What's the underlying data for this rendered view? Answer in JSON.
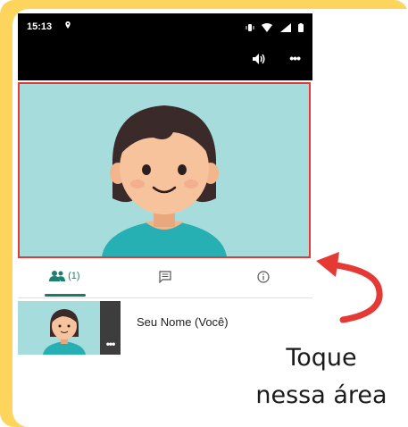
{
  "status_bar": {
    "time": "15:13",
    "icons": [
      "location-icon",
      "vibrate-icon",
      "wifi-icon",
      "signal-icon",
      "battery-icon"
    ]
  },
  "call_toolbar": {
    "icons": [
      "speaker-icon",
      "more-options-icon"
    ],
    "more_label": "•••"
  },
  "tabs": [
    {
      "icon": "people-icon",
      "label": "(1)",
      "active": true
    },
    {
      "icon": "chat-icon",
      "label": ""
    },
    {
      "icon": "info-icon",
      "label": ""
    }
  ],
  "participant": {
    "name": "Seu Nome (Você)",
    "more_label": "•••"
  },
  "annotation": {
    "line1": "Toque",
    "line2": "nessa área"
  },
  "colors": {
    "background_frame": "#fdd45c",
    "video_bg": "#a6dcdb",
    "highlight_border": "#e53935",
    "accent": "#1a7a6b",
    "arrow": "#e53935"
  }
}
